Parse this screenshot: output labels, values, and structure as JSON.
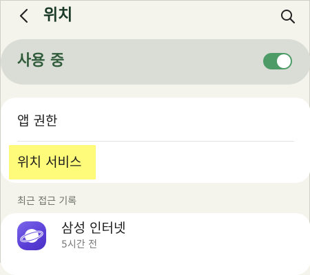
{
  "header": {
    "title": "위치",
    "back_icon": "chevron-left-icon",
    "search_icon": "search-icon"
  },
  "master_toggle": {
    "label": "사용 중",
    "state": "on",
    "color": "#4d9c68"
  },
  "menu": {
    "items": [
      {
        "label": "앱 권한"
      },
      {
        "label": "위치 서비스",
        "highlight_color": "#fffb7a"
      }
    ]
  },
  "recent": {
    "section_title": "최근 접근 기록",
    "items": [
      {
        "app_name": "삼성 인터넷",
        "time": "5시간 전",
        "icon": "samsung-internet-icon"
      }
    ]
  }
}
